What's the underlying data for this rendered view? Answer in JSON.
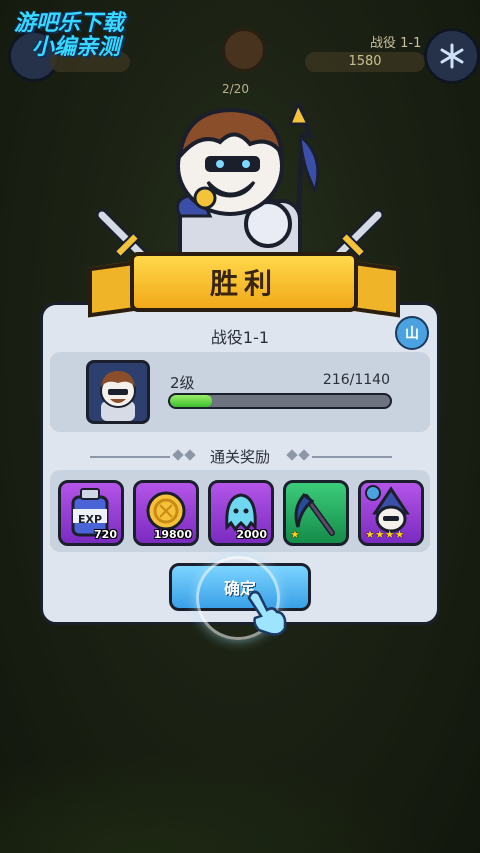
{
  "watermark": {
    "line1": "游吧乐下载",
    "line2": "小编亲测"
  },
  "hud": {
    "stage": "战役 1-1",
    "power": "1580",
    "progress": "2/20"
  },
  "banner": {
    "title": "胜利"
  },
  "panel": {
    "title": "战役1-1",
    "map_button": "山",
    "level": {
      "label": "2级",
      "exp_text": "216/1140",
      "exp_fraction": 0.19
    },
    "reward_header": "通关奖励",
    "rewards": [
      {
        "name": "exp-potion",
        "amount": "720",
        "label": "EXP",
        "bg": "purple"
      },
      {
        "name": "gold-coin",
        "amount": "19800",
        "bg": "purple"
      },
      {
        "name": "soul",
        "amount": "2000",
        "bg": "purple"
      },
      {
        "name": "scythe",
        "stars": "★",
        "bg": "green"
      },
      {
        "name": "hero-card",
        "stars": "★★★★",
        "bg": "purple"
      }
    ],
    "confirm_button": "确定"
  },
  "colors": {
    "panel": "#dfe5ef",
    "ribbon": "#f1a91a",
    "button": "#3aa0e6",
    "exp": "#3dbe2e"
  }
}
